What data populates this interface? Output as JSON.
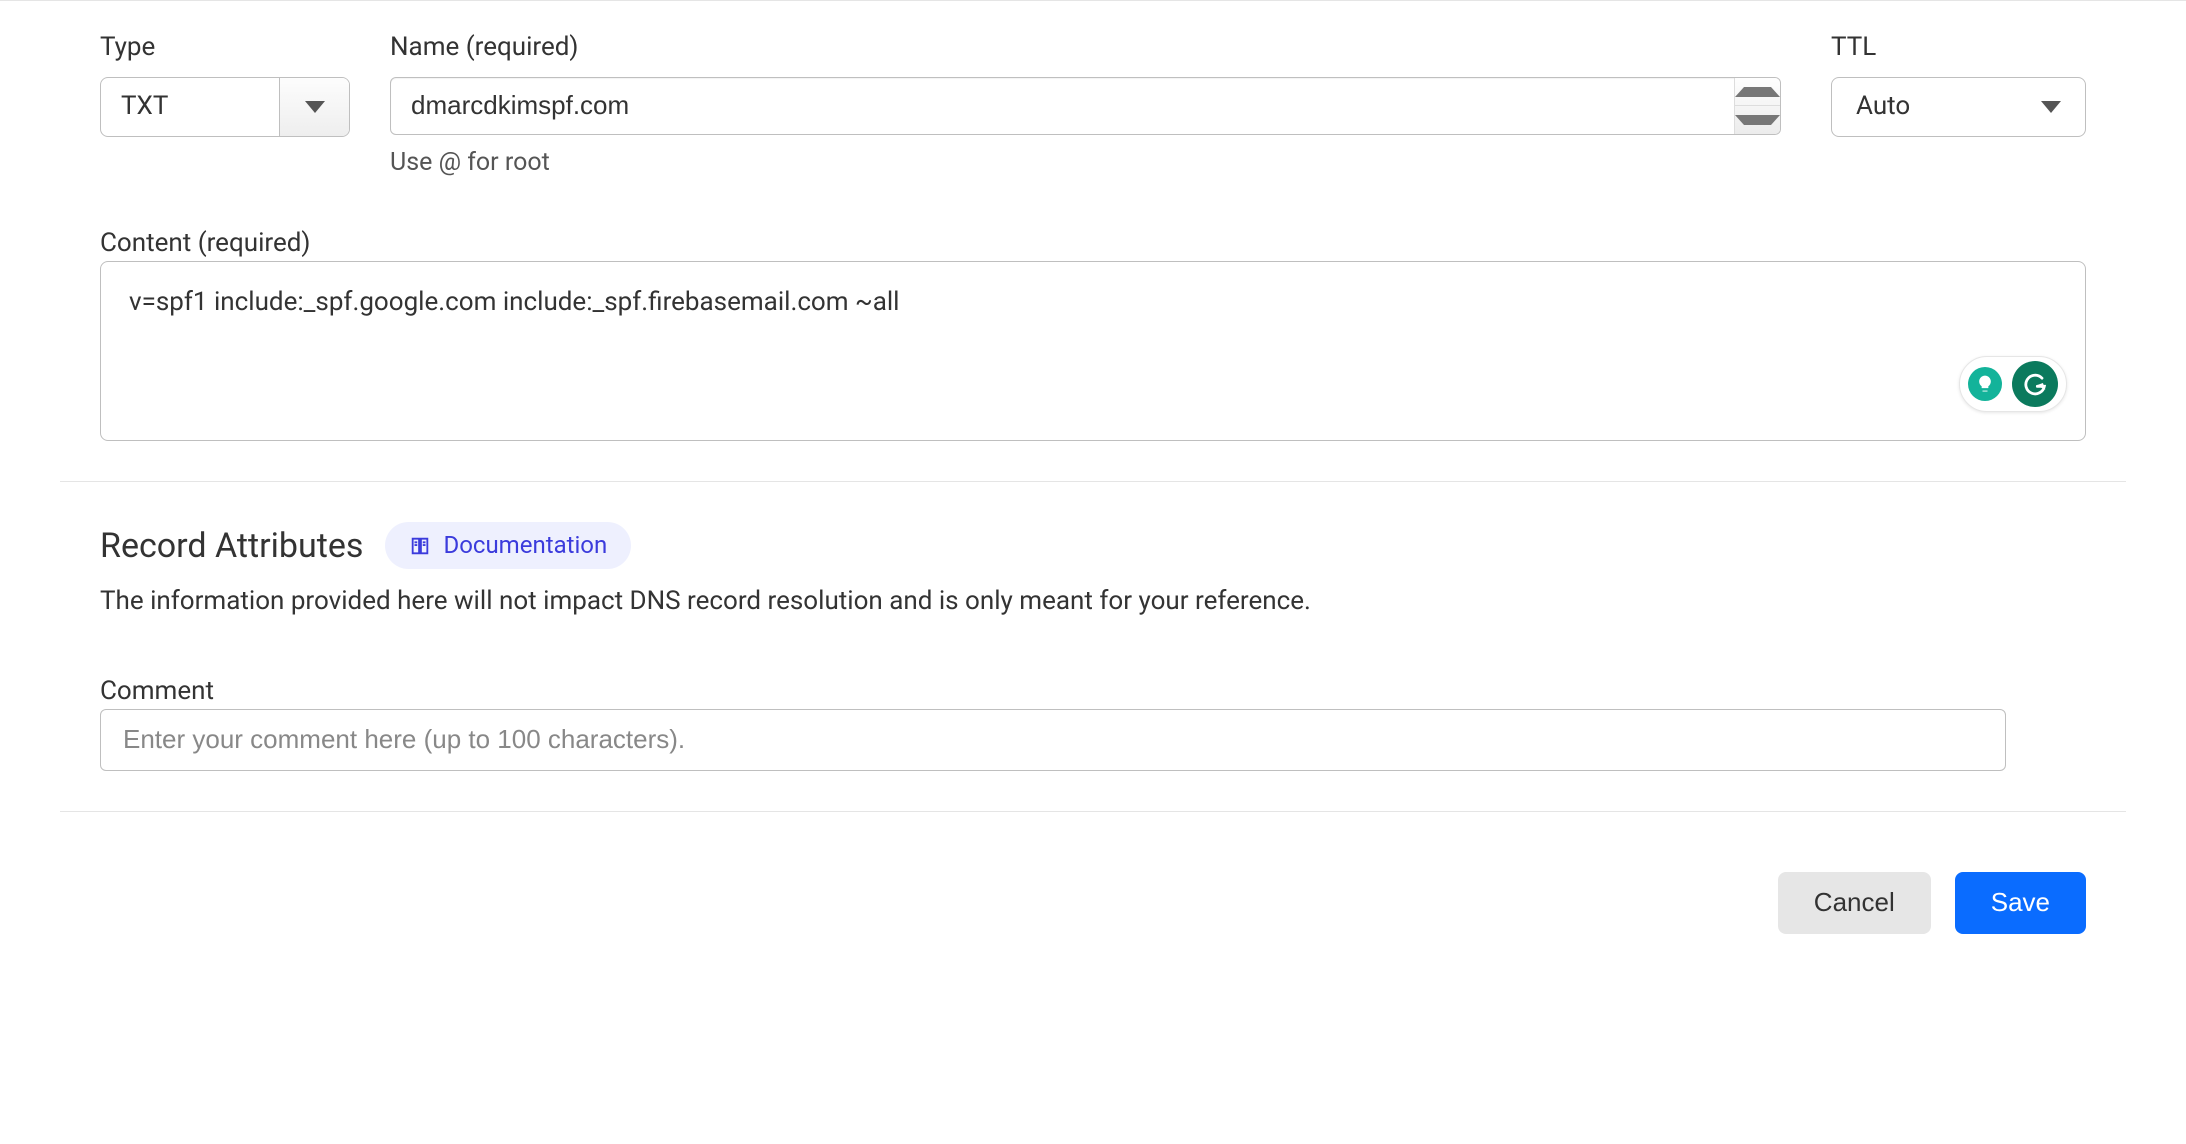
{
  "type": {
    "label": "Type",
    "value": "TXT"
  },
  "name": {
    "label": "Name (required)",
    "value": "dmarcdkimspf.com",
    "hint": "Use @ for root"
  },
  "ttl": {
    "label": "TTL",
    "value": "Auto"
  },
  "content": {
    "label": "Content (required)",
    "value": "v=spf1 include:_spf.google.com include:_spf.firebasemail.com ~all"
  },
  "attrs": {
    "title": "Record Attributes",
    "documentation_label": "Documentation",
    "description": "The information provided here will not impact DNS record resolution and is only meant for your reference."
  },
  "comment": {
    "label": "Comment",
    "placeholder": "Enter your comment here (up to 100 characters)."
  },
  "footer": {
    "cancel_label": "Cancel",
    "save_label": "Save"
  }
}
